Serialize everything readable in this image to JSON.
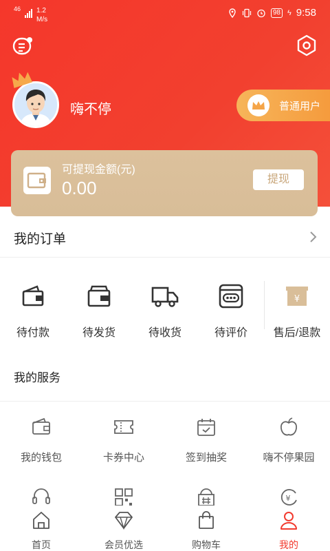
{
  "status_bar": {
    "signal": "46",
    "speed_value": "1.2",
    "speed_unit": "M/s",
    "battery": "98",
    "time": "9:58"
  },
  "profile": {
    "username": "嗨不停",
    "member_level": "普通用户"
  },
  "wallet": {
    "label": "可提现金额(元)",
    "amount": "0.00",
    "withdraw_button": "提现"
  },
  "orders": {
    "title": "我的订单",
    "items": [
      {
        "label": "待付款",
        "icon": "wallet-icon"
      },
      {
        "label": "待发货",
        "icon": "box-icon"
      },
      {
        "label": "待收货",
        "icon": "truck-icon"
      },
      {
        "label": "待评价",
        "icon": "comment-icon"
      },
      {
        "label": "售后/退款",
        "icon": "yuan-box-icon"
      }
    ]
  },
  "services": {
    "title": "我的服务",
    "items": [
      {
        "label": "我的钱包",
        "icon": "wallet-icon"
      },
      {
        "label": "卡券中心",
        "icon": "ticket-icon"
      },
      {
        "label": "签到抽奖",
        "icon": "calendar-check-icon"
      },
      {
        "label": "嗨不停果园",
        "icon": "apple-icon"
      },
      {
        "label": "",
        "icon": "headset-icon"
      },
      {
        "label": "",
        "icon": "qr-code-icon"
      },
      {
        "label": "",
        "icon": "shop-icon"
      },
      {
        "label": "",
        "icon": "yuan-exchange-icon"
      }
    ]
  },
  "tabbar": {
    "items": [
      {
        "label": "首页",
        "icon": "home-icon"
      },
      {
        "label": "会员优选",
        "icon": "diamond-icon"
      },
      {
        "label": "购物车",
        "icon": "shopping-bag-icon"
      },
      {
        "label": "我的",
        "icon": "user-icon"
      }
    ],
    "active_index": 3
  },
  "colors": {
    "primary_red": "#f23a2e",
    "gold": "#d9be99",
    "orange": "#f5a548"
  }
}
